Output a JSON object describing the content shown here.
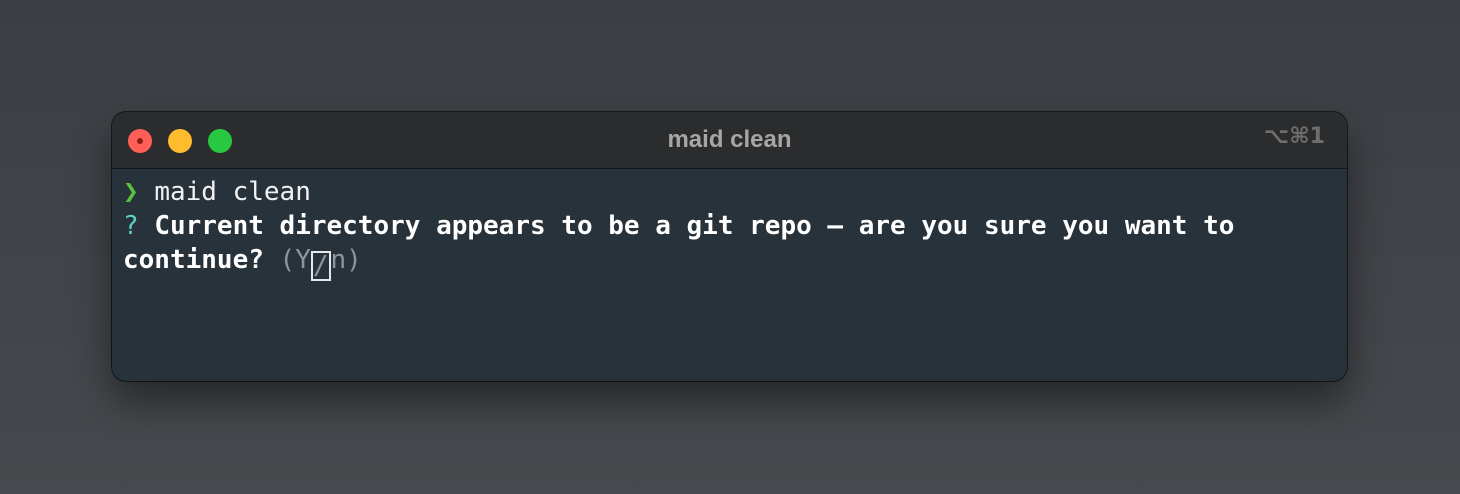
{
  "window": {
    "title": "maid clean",
    "shortcut": "⌥⌘1"
  },
  "terminal": {
    "prompt_symbol": "❯",
    "command": "maid clean",
    "question_mark": "?",
    "question_line1": "Current directory appears to be a git repo – are you sure you want to",
    "question_line2": "continue?",
    "hint_open": "(Y",
    "hint_cursor": "/",
    "hint_close": "n)"
  }
}
